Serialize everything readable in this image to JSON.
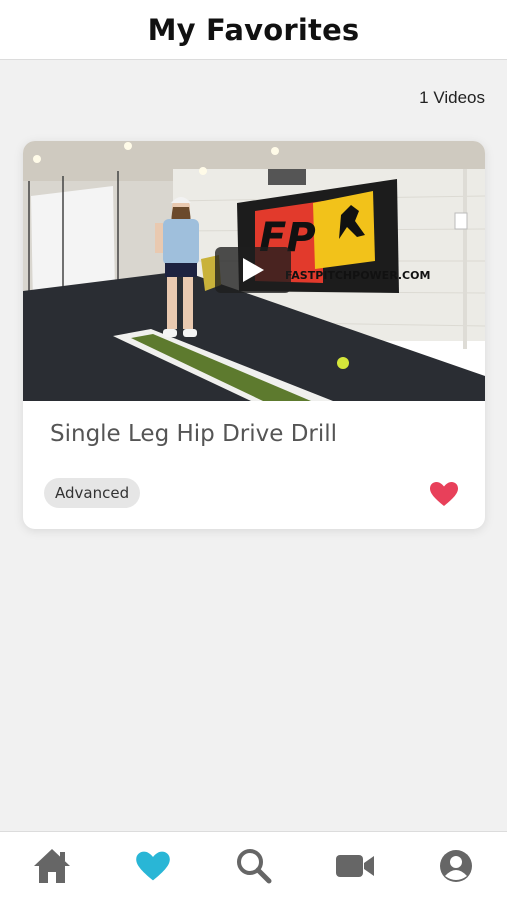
{
  "header": {
    "title": "My Favorites"
  },
  "summary": {
    "count_label": "1 Videos"
  },
  "videos": [
    {
      "title": "Single Leg Hip Drive Drill",
      "level": "Advanced",
      "favorited": true,
      "thumbnail_banner_text": "FASTPITCHPOWER.COM"
    }
  ],
  "tabbar": {
    "items": [
      {
        "icon": "home-icon",
        "active": false
      },
      {
        "icon": "heart-icon",
        "active": true
      },
      {
        "icon": "search-icon",
        "active": false
      },
      {
        "icon": "video-camera-icon",
        "active": false
      },
      {
        "icon": "profile-icon",
        "active": false
      }
    ]
  },
  "colors": {
    "active_tab": "#29b6d6",
    "inactive_tab": "#666666",
    "favorite_heart": "#e8405a",
    "badge_bg": "#e6e6e6"
  }
}
